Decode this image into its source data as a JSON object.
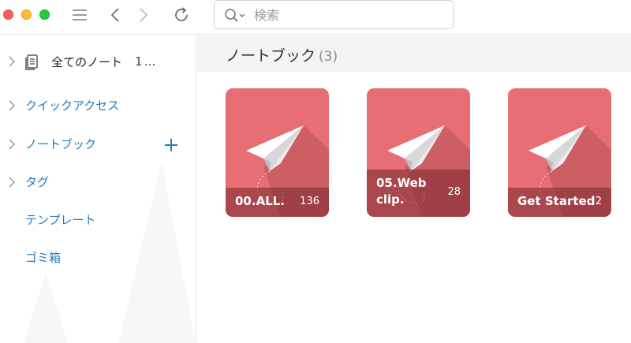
{
  "toolbar": {
    "search_placeholder": "検索"
  },
  "sidebar": {
    "all_notes": {
      "label": "全てのノート",
      "count": "1",
      "ellipsis": "..."
    },
    "items": [
      {
        "label": "クイックアクセス"
      },
      {
        "label": "ノートブック"
      },
      {
        "label": "タグ"
      },
      {
        "label": "テンプレート"
      },
      {
        "label": "ゴミ箱"
      }
    ]
  },
  "main": {
    "section_title": "ノートブック",
    "section_count": "(3)",
    "notebooks": [
      {
        "name": "00.ALL.",
        "count": "136"
      },
      {
        "name": "05.Web clip.",
        "count": "28"
      },
      {
        "name": "Get Started",
        "count": "2"
      }
    ]
  },
  "colors": {
    "accent": "#1f7fc4",
    "notebook_cover": "#e66e74"
  },
  "icons": [
    "menu-icon",
    "back-arrow-icon",
    "forward-arrow-icon",
    "reload-icon",
    "search-icon",
    "chevron-right-icon",
    "notes-icon",
    "plus-icon",
    "paper-plane-icon"
  ]
}
